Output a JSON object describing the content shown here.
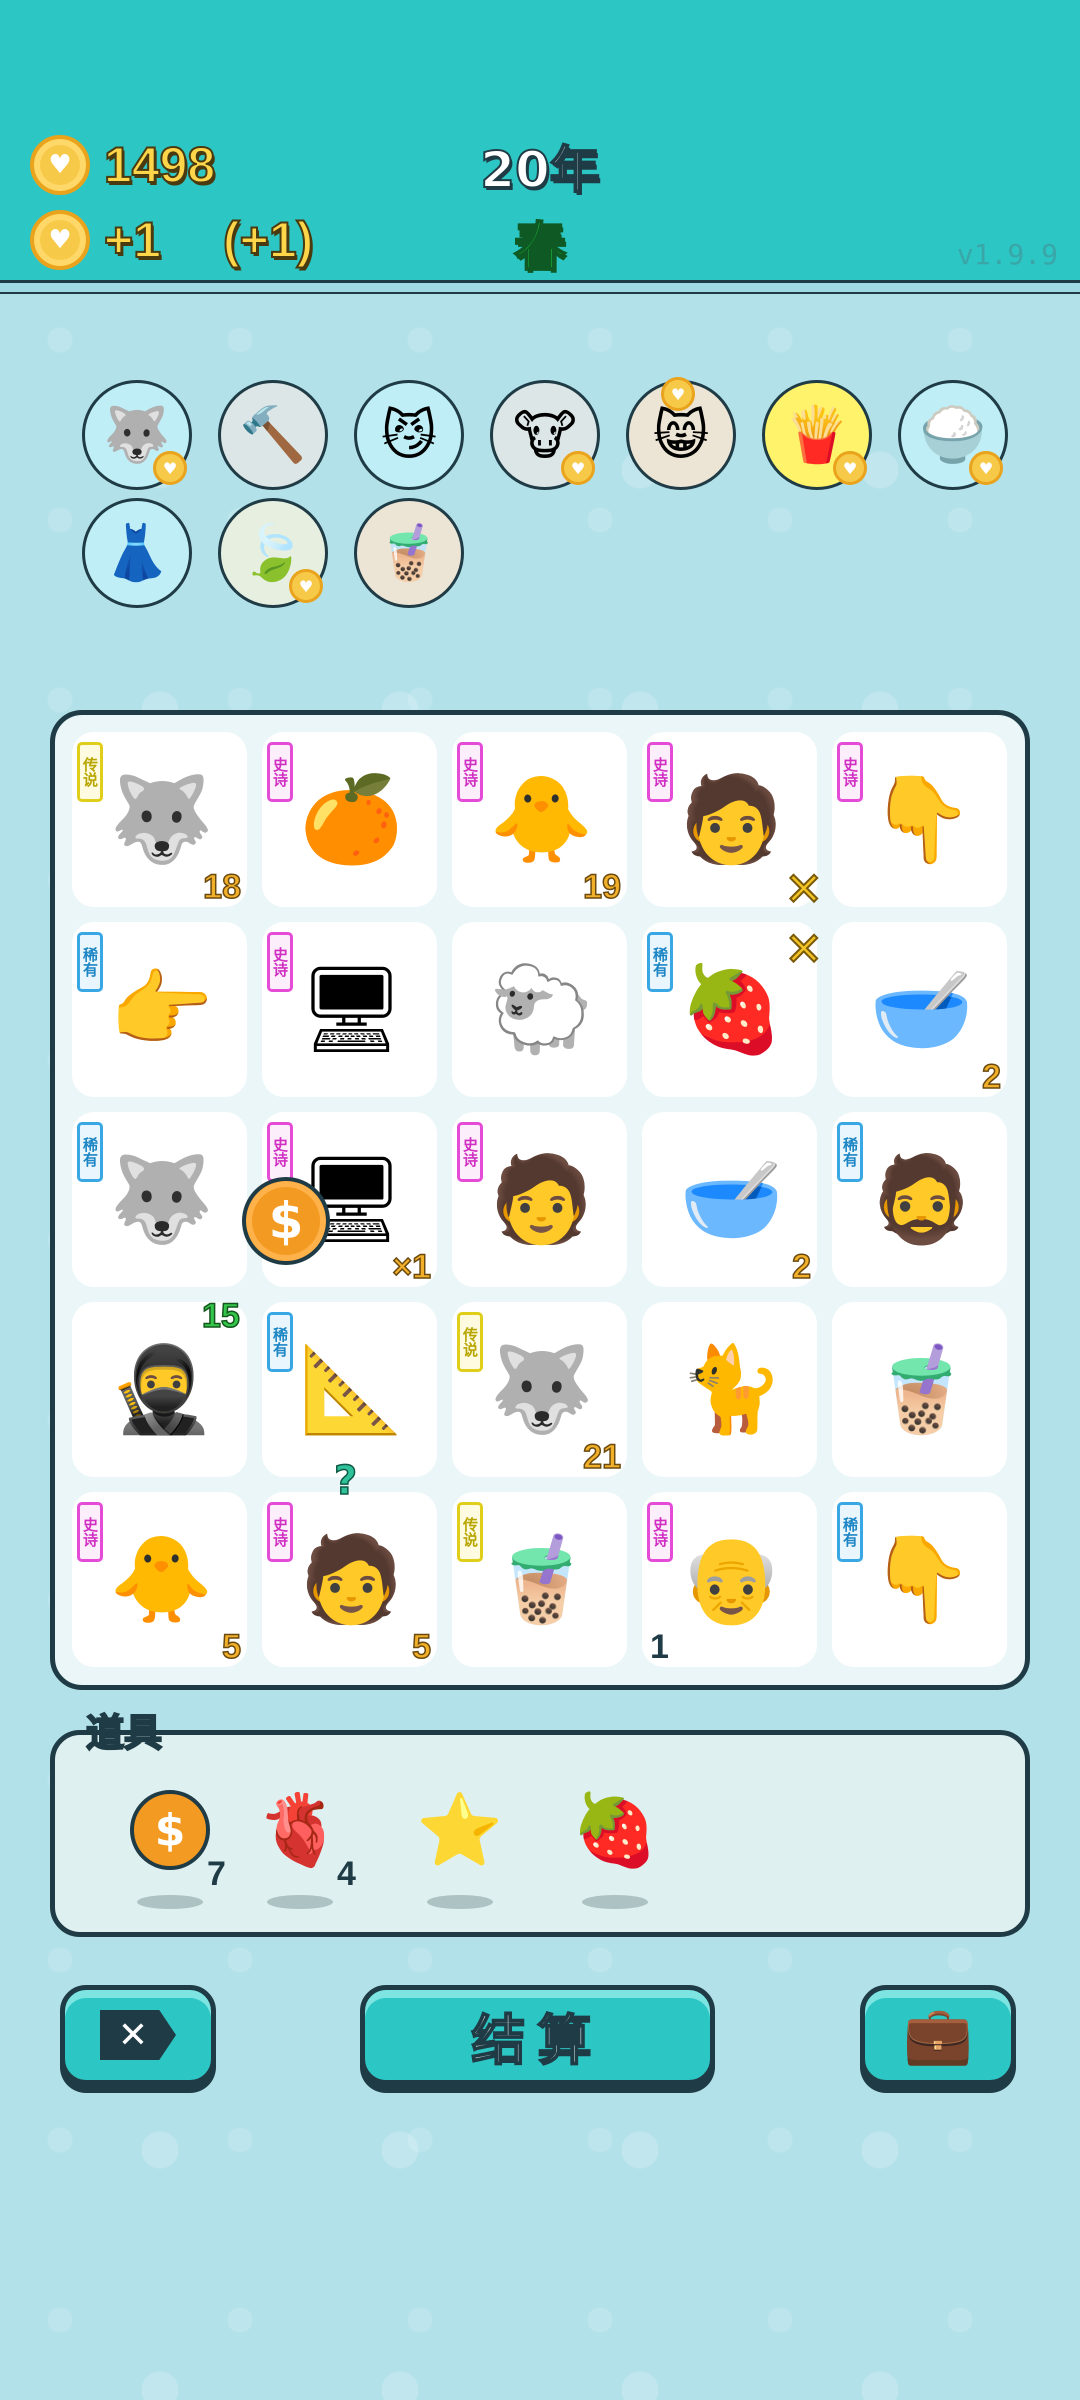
{
  "header": {
    "coins": "1498",
    "income": "+1",
    "bonus_income": "(+1)",
    "year": "20年",
    "season": "春",
    "version": "v1.9.9"
  },
  "equipped_items": [
    {
      "name": "husky-icon",
      "glyph": "🐺",
      "style": "cyan",
      "heart": true
    },
    {
      "name": "hammer-icon",
      "glyph": "🔨",
      "style": "",
      "heart": false
    },
    {
      "name": "cool-cat-icon",
      "glyph": "😼",
      "style": "cyan",
      "heart": false
    },
    {
      "name": "cow-pair-icon",
      "glyph": "🐮",
      "style": "",
      "heart": true
    },
    {
      "name": "cat-pair-icon",
      "glyph": "😸",
      "style": "tan",
      "heart": true,
      "heart_top": true
    },
    {
      "name": "fries-icon",
      "glyph": "🍟",
      "style": "yellow",
      "heart": true
    },
    {
      "name": "rice-bowl-icon",
      "glyph": "🍚",
      "style": "cyan",
      "heart": true
    },
    {
      "name": "skirt-icon",
      "glyph": "👗",
      "style": "cyan",
      "heart": false
    },
    {
      "name": "leaf-icon",
      "glyph": "🍃",
      "style": "green",
      "heart": true
    },
    {
      "name": "bubble-tea-icon",
      "glyph": "🧋",
      "style": "tan",
      "heart": false
    }
  ],
  "board": [
    {
      "badge": "传说",
      "rarity": "legend",
      "glyph": "🐺",
      "name": "king-husky",
      "count": "18"
    },
    {
      "badge": "史诗",
      "rarity": "epic",
      "glyph": "🍊",
      "name": "orange",
      "count": ""
    },
    {
      "badge": "史诗",
      "rarity": "epic",
      "glyph": "🐥",
      "name": "chick",
      "count": "19"
    },
    {
      "badge": "史诗",
      "rarity": "epic",
      "glyph": "🧑",
      "name": "green-hat-man",
      "count": "",
      "x": true
    },
    {
      "badge": "史诗",
      "rarity": "epic",
      "glyph": "👇",
      "name": "grey-hand",
      "count": ""
    },
    {
      "badge": "稀有",
      "rarity": "rare",
      "glyph": "👉",
      "name": "brown-hand",
      "count": ""
    },
    {
      "badge": "史诗",
      "rarity": "epic",
      "glyph": "🖥",
      "name": "gpu",
      "count": ""
    },
    {
      "badge": "",
      "rarity": "",
      "glyph": "🐑",
      "name": "sheep",
      "count": ""
    },
    {
      "badge": "稀有",
      "rarity": "rare",
      "glyph": "🍓",
      "name": "lychee",
      "count": "",
      "x": true
    },
    {
      "badge": "",
      "rarity": "",
      "glyph": "🥣",
      "name": "soup-bowl",
      "count": "2"
    },
    {
      "badge": "稀有",
      "rarity": "rare",
      "glyph": "🐺",
      "name": "husky",
      "count": ""
    },
    {
      "badge": "史诗",
      "rarity": "epic",
      "glyph": "🖥",
      "name": "gpu-2",
      "count": "×1",
      "coin": true
    },
    {
      "badge": "史诗",
      "rarity": "epic",
      "glyph": "🧑",
      "name": "green-hat-man-2",
      "count": ""
    },
    {
      "badge": "",
      "rarity": "",
      "glyph": "🥣",
      "name": "soup-bowl-2",
      "count": "2"
    },
    {
      "badge": "稀有",
      "rarity": "rare",
      "glyph": "🧔",
      "name": "bucket-hat-man",
      "count": ""
    },
    {
      "badge": "",
      "rarity": "",
      "glyph": "🥷",
      "name": "thief",
      "count": "15",
      "count_style": "green"
    },
    {
      "badge": "稀有",
      "rarity": "rare",
      "glyph": "📐",
      "name": "fan-ruler",
      "count": ""
    },
    {
      "badge": "传说",
      "rarity": "legend",
      "glyph": "🐺",
      "name": "king-husky-2",
      "count": "21"
    },
    {
      "badge": "",
      "rarity": "",
      "glyph": "🐈",
      "name": "yellow-cat",
      "count": ""
    },
    {
      "badge": "",
      "rarity": "",
      "glyph": "🧋",
      "name": "small-tea",
      "count": ""
    },
    {
      "badge": "史诗",
      "rarity": "epic",
      "glyph": "🐥",
      "name": "chick-2",
      "count": "5"
    },
    {
      "badge": "史诗",
      "rarity": "epic",
      "glyph": "🧑",
      "name": "green-hat-man-3",
      "count": "5",
      "question": true
    },
    {
      "badge": "传说",
      "rarity": "legend",
      "glyph": "🧋",
      "name": "big-tea",
      "count": ""
    },
    {
      "badge": "史诗",
      "rarity": "epic",
      "glyph": "👴",
      "name": "old-man",
      "count": "1",
      "count_style": "dark"
    },
    {
      "badge": "稀有",
      "rarity": "rare",
      "glyph": "👇",
      "name": "brown-hand-2",
      "count": ""
    }
  ],
  "tools": {
    "label": "道具",
    "items": [
      {
        "name": "coin-tool",
        "glyph": "$",
        "count": "7"
      },
      {
        "name": "liver-tool",
        "glyph": "🫀",
        "count": "4"
      },
      {
        "name": "star-tool",
        "glyph": "⭐",
        "count": ""
      },
      {
        "name": "strawberry-tool",
        "glyph": "🍓",
        "count": ""
      }
    ]
  },
  "buttons": {
    "close": "✕",
    "settle": "结算",
    "bag": "💼"
  },
  "colors": {
    "header": "#2cc6c4",
    "background": "#b3e1ea",
    "outline": "#1f3b45",
    "gold": "#ffd64a",
    "season": "#1ccf3a"
  }
}
